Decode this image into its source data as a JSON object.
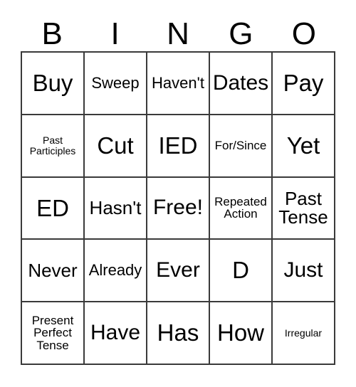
{
  "card": {
    "headers": [
      "B",
      "I",
      "N",
      "G",
      "O"
    ],
    "rows": [
      [
        {
          "text": "Buy",
          "size": "fs-xxl"
        },
        {
          "text": "Sweep",
          "size": "fs-m"
        },
        {
          "text": "Haven't",
          "size": "fs-m"
        },
        {
          "text": "Dates",
          "size": "fs-xl"
        },
        {
          "text": "Pay",
          "size": "fs-xxl"
        }
      ],
      [
        {
          "text": "Past\nParticiples",
          "size": "fs-xs"
        },
        {
          "text": "Cut",
          "size": "fs-xxl"
        },
        {
          "text": "IED",
          "size": "fs-xxl"
        },
        {
          "text": "For/Since",
          "size": "fs-s"
        },
        {
          "text": "Yet",
          "size": "fs-xxl"
        }
      ],
      [
        {
          "text": "ED",
          "size": "fs-xxl"
        },
        {
          "text": "Hasn't",
          "size": "fs-l"
        },
        {
          "text": "Free!",
          "size": "fs-xl"
        },
        {
          "text": "Repeated\nAction",
          "size": "fs-s"
        },
        {
          "text": "Past\nTense",
          "size": "fs-l"
        }
      ],
      [
        {
          "text": "Never",
          "size": "fs-l"
        },
        {
          "text": "Already",
          "size": "fs-m"
        },
        {
          "text": "Ever",
          "size": "fs-xl"
        },
        {
          "text": "D",
          "size": "fs-xxl"
        },
        {
          "text": "Just",
          "size": "fs-xl"
        }
      ],
      [
        {
          "text": "Present\nPerfect\nTense",
          "size": "fs-s"
        },
        {
          "text": "Have",
          "size": "fs-xl"
        },
        {
          "text": "Has",
          "size": "fs-xxl"
        },
        {
          "text": "How",
          "size": "fs-xxl"
        },
        {
          "text": "Irregular",
          "size": "fs-xs"
        }
      ]
    ],
    "colors": {
      "border": "#3a3a3a",
      "background": "#ffffff",
      "text": "#000000"
    }
  }
}
